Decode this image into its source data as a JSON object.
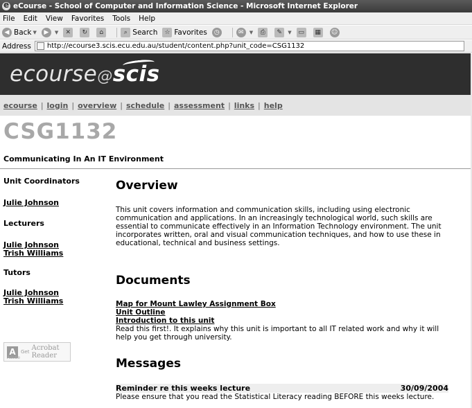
{
  "window": {
    "title": "eCourse - School of Computer and Information Science - Microsoft Internet Explorer"
  },
  "menu": [
    "File",
    "Edit",
    "View",
    "Favorites",
    "Tools",
    "Help"
  ],
  "toolbar": {
    "back": "Back",
    "search": "Search",
    "favorites": "Favorites"
  },
  "address": {
    "label": "Address",
    "url": "http://ecourse3.scis.ecu.edu.au/student/content.php?unit_code=CSG1132"
  },
  "logo": {
    "part1": "ecourse",
    "part2": "@",
    "part3": "scis"
  },
  "nav": {
    "items": [
      "ecourse",
      "login",
      "overview",
      "schedule",
      "assessment",
      "links",
      "help"
    ],
    "separator": "|"
  },
  "unit": {
    "code": "CSG1132",
    "name": "Communicating In An IT Environment"
  },
  "sidebar": {
    "coordinators_heading": "Unit Coordinators",
    "coordinators": [
      "Julie Johnson"
    ],
    "lecturers_heading": "Lecturers",
    "lecturers": [
      "Julie Johnson",
      "Trish Williams"
    ],
    "tutors_heading": "Tutors",
    "tutors": [
      "Julie Johnson",
      "Trish Williams"
    ],
    "reader_badge": {
      "get": "Get",
      "line1": "Acrobat",
      "line2": "Reader",
      "brand": "Adobe"
    }
  },
  "overview": {
    "heading": "Overview",
    "text": "This unit covers information and communication skills, including using electronic communication and applications. In an increasingly technological world, such skills are essential to communicate effectively in an Information Technology environment. The unit incorporates written, oral and visual communication techniques, and how to use these in educational, technical and business settings."
  },
  "documents": {
    "heading": "Documents",
    "links": [
      "Map for Mount Lawley Assignment Box",
      "Unit Outline",
      "Introduction to this unit"
    ],
    "note": "Read this first!. It explains why this unit is important to all IT related work and why it will help you get through university."
  },
  "messages": {
    "heading": "Messages",
    "items": [
      {
        "title": "Reminder re this weeks lecture",
        "date": "30/09/2004",
        "body": "Please ensure that you read the Statistical Literacy reading BEFORE this weeks lecture."
      }
    ]
  }
}
